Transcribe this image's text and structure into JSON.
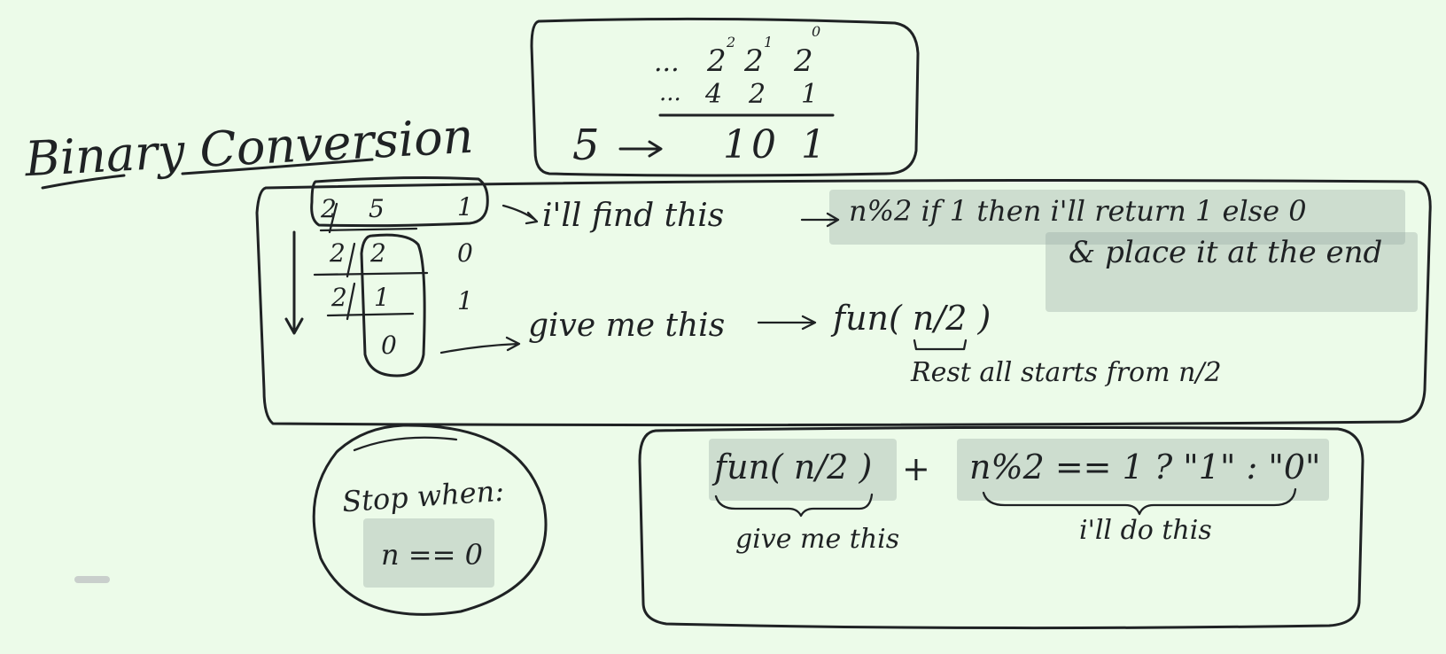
{
  "title": "Binary Conversion",
  "place_values": {
    "powers": {
      "lead": "...",
      "p2": "2",
      "p2_exp": "2",
      "p1": "2",
      "p1_exp": "1",
      "p0": "2",
      "p0_exp": "0"
    },
    "values": {
      "lead": "...",
      "v4": "4",
      "v2": "2",
      "v1": "1"
    },
    "input": "5",
    "bits": [
      "1",
      "0",
      "1"
    ]
  },
  "division_table": {
    "rows": [
      {
        "divisor": "2",
        "dividend": "5",
        "remainder": "1"
      },
      {
        "divisor": "2",
        "dividend": "2",
        "remainder": "0"
      },
      {
        "divisor": "2",
        "dividend": "1",
        "remainder": "1"
      }
    ],
    "final": "0"
  },
  "notes": {
    "find_label": "i'll find this",
    "find_expr": "n%2 if 1 then i'll return 1 else 0",
    "find_expr_line2": "& place it at the end",
    "give_label": "give me this",
    "give_expr": "fun( n/2 )",
    "rest_note": "Rest all starts from n/2"
  },
  "stop": {
    "label": "Stop when:",
    "condition": "n == 0"
  },
  "formula": {
    "call": "fun( n/2 )",
    "plus": "+",
    "ternary": "n%2 == 1 ? \"1\" : \"0\"",
    "call_note": "give me this",
    "ternary_note": "i'll do this"
  }
}
